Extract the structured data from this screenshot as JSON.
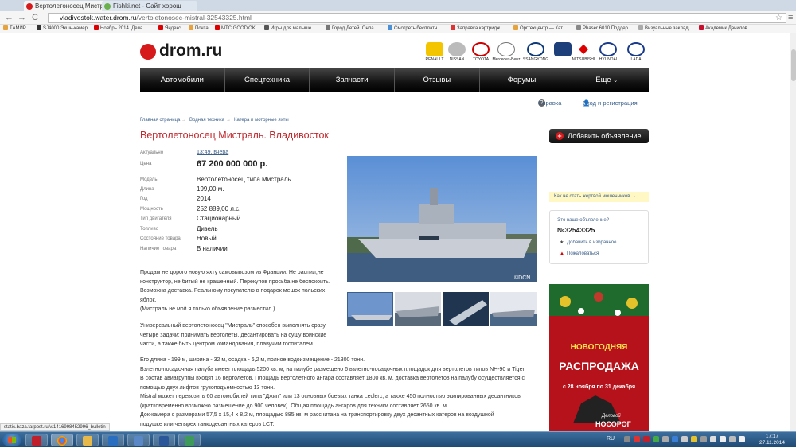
{
  "browser": {
    "tabs": [
      {
        "title": "Вертолетоносец Мистраль",
        "active": true
      },
      {
        "title": "Fishki.net - Сайт хорош",
        "active": false
      }
    ],
    "url_host": "vladivostok.water.drom.ru",
    "url_path": "/vertoletonosec-mistral-32543325.html",
    "nav": {
      "back": "←",
      "forward": "→",
      "reload": "C"
    },
    "star": "☆",
    "menu": "≡",
    "bookmarks": [
      "ТАМИР",
      "SJ4000 Экшн-камер...",
      "Ноябрь 2014. Дела ...",
      "Яндекс",
      "Почта",
      "МТС GOOD'OK",
      "Игры для малыше...",
      "Город Детей. Онла...",
      "Смотреть бесплатн...",
      "Заправка картридж...",
      "Оргтехцентр — Кат...",
      "Phaser 6010 Поддер...",
      "Визуальные заклад...",
      "Академик Данилов ..."
    ],
    "status_url": "static.baza.farpost.ru/v/1416998452996_bulletin"
  },
  "site": {
    "logo": "drom.ru",
    "brands": [
      "RENAULT",
      "NISSAN",
      "TOYOTA",
      "Mercedes-Benz",
      "SSANGYONG",
      "MITSUBISHI",
      "HYUNDAI",
      "LADA"
    ],
    "nav": [
      "Автомобили",
      "Спецтехника",
      "Запчасти",
      "Отзывы",
      "Форумы",
      "Еще"
    ],
    "help": "Справка",
    "login": "Вход и регистрация"
  },
  "breadcrumbs": [
    "Главная страница",
    "Водная техника",
    "Катера и моторные яхты"
  ],
  "listing": {
    "title": "Вертолетоносец Мистраль. Владивосток",
    "specs": [
      {
        "key": "Актуально",
        "value": "13:49, вчера",
        "link": true
      },
      {
        "key": "Цена",
        "value": "67 200 000 000 р.",
        "price": true
      },
      {
        "key": "Модель",
        "value": "Вертолетоносец типа Мистраль"
      },
      {
        "key": "Длина",
        "value": "199,00 м."
      },
      {
        "key": "Год",
        "value": "2014"
      },
      {
        "key": "Мощность",
        "value": "252 889,00 л.с."
      },
      {
        "key": "Тип двигателя",
        "value": "Стационарный"
      },
      {
        "key": "Топливо",
        "value": "Дизель"
      },
      {
        "key": "Состояние товара",
        "value": "Новый"
      },
      {
        "key": "Наличие товара",
        "value": "В наличии"
      }
    ],
    "photo_credit": "©DCN",
    "desc1": "Продам не дорого новую яхту самовывозом из Франции. Не распил,не конструктор, не битый не крашенный. Перекупов просьба не беспокоить. Возможна доставка. Реальному покупателю в подарок мешок польских яблок.",
    "desc1b": "(Мистраль не мой я только объявление разместил.)",
    "desc2": "Универсальный вертолетоносец \"Мистраль\" способен выполнять сразу четыре задачи: принимать вертолеты, десантировать на сушу воинские части, а также быть центром командования, плавучим госпиталем.",
    "desc3_lines": [
      "Его длина - 199 м, ширина - 32 м, осадка - 6,2 м, полное водоизмещение - 21300 тонн.",
      "Взлетно-посадочная палуба имеет площадь 5200 кв. м, на палубе размещено 6 взлетно-посадочных площадок для вертолетов типов NH-90 и Tiger.",
      "В состав авиагруппы входят 16 вертолетов. Площадь вертолетного ангара составляет 1800 кв. м, доставка вертолетов на палубу осуществляется с помощью двух лифтов грузоподъемностью 13 тонн.",
      "Mistral может перевозить 60 автомобилей типа \"Джип\" или 13 основных боевых танка Leclerc, а также 450 полностью экипированных десантников (кратковременно возможно размещение до 900 человек). Общая площадь ангаров для техники составляет 2650 кв. м.",
      "Док-камера с размерами 57,5 x 15,4 x 8,2 м, площадью 885 кв. м рассчитана на транспортировку двух десантных катеров на воздушной",
      "подушке или четырех танкодесантных катеров LCT."
    ]
  },
  "sidebar": {
    "add_button": "Добавить объявление",
    "fraud_link": "Как не стать жертвой мошенников →",
    "question": "Это ваше объявление?",
    "number": "№32543325",
    "favorite": "Добавить в избранное",
    "complain": "Пожаловаться"
  },
  "banner": {
    "top": "НОВОГОДНЯЯ",
    "sale": "РАСПРОДАЖА",
    "dates": "с 28 ноября по 31 декабря",
    "brand_small": "Деловой",
    "brand": "НОСОРОГ"
  },
  "taskbar": {
    "lang": "RU",
    "time": "17:17",
    "date": "27.11.2014"
  }
}
